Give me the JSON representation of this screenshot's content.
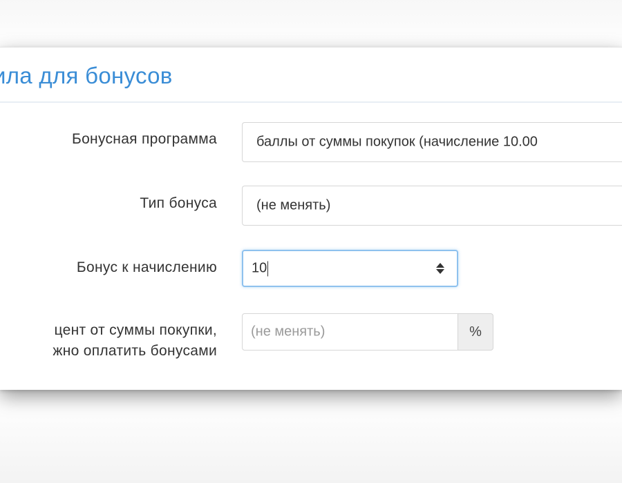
{
  "panel": {
    "title": "ила для бонусов"
  },
  "form": {
    "program": {
      "label": "Бонусная программа",
      "value": "баллы от суммы покупок (начисление 10.00"
    },
    "bonus_type": {
      "label": "Тип бонуса",
      "value": "(не менять)"
    },
    "bonus_amount": {
      "label": "Бонус к начислению",
      "value": "10"
    },
    "percent": {
      "label_line1": "цент от суммы покупки,",
      "label_line2": "жно оплатить бонусами",
      "placeholder": "(не менять)",
      "addon": "%"
    }
  },
  "colors": {
    "title": "#3a8dd6",
    "focus_border": "#8ec1ee",
    "addon_bg": "#eeeeee"
  }
}
